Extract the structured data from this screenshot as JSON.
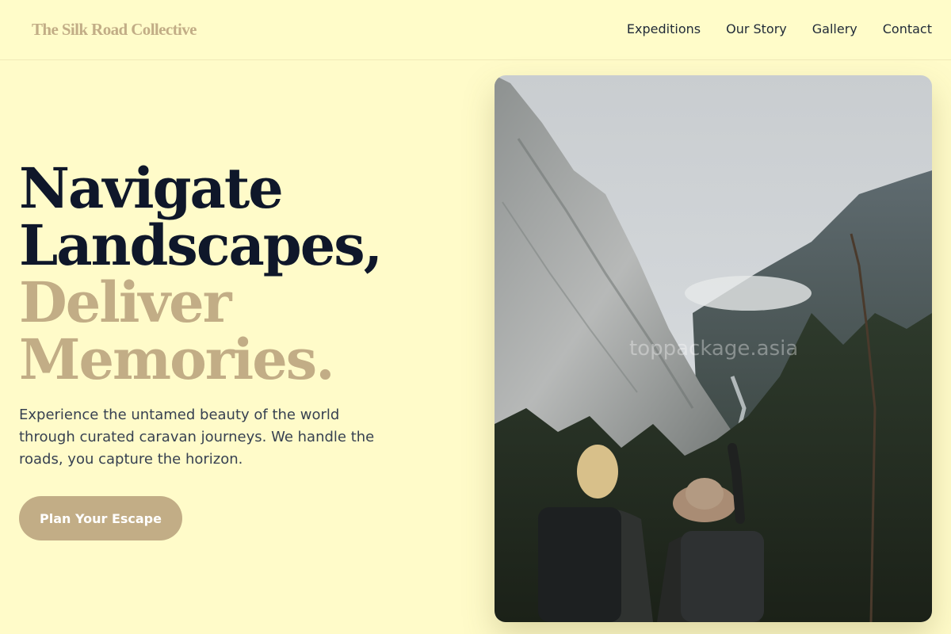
{
  "brand": {
    "name": "The Silk Road Collective"
  },
  "nav": {
    "items": [
      "Expeditions",
      "Our Story",
      "Gallery",
      "Contact"
    ]
  },
  "hero": {
    "line1": "Navigate",
    "line2": "Landscapes,",
    "line3": "Deliver",
    "line4": "Memories.",
    "subtitle": "Experience the untamed beauty of the world through curated caravan journeys. We handle the roads, you capture the horizon.",
    "cta_label": "Plan Your Escape"
  },
  "photo": {
    "watermark": "toppackage.asia"
  },
  "colors": {
    "background": "#fffbc9",
    "accent": "#c2ad86",
    "heading": "#0f172a"
  }
}
